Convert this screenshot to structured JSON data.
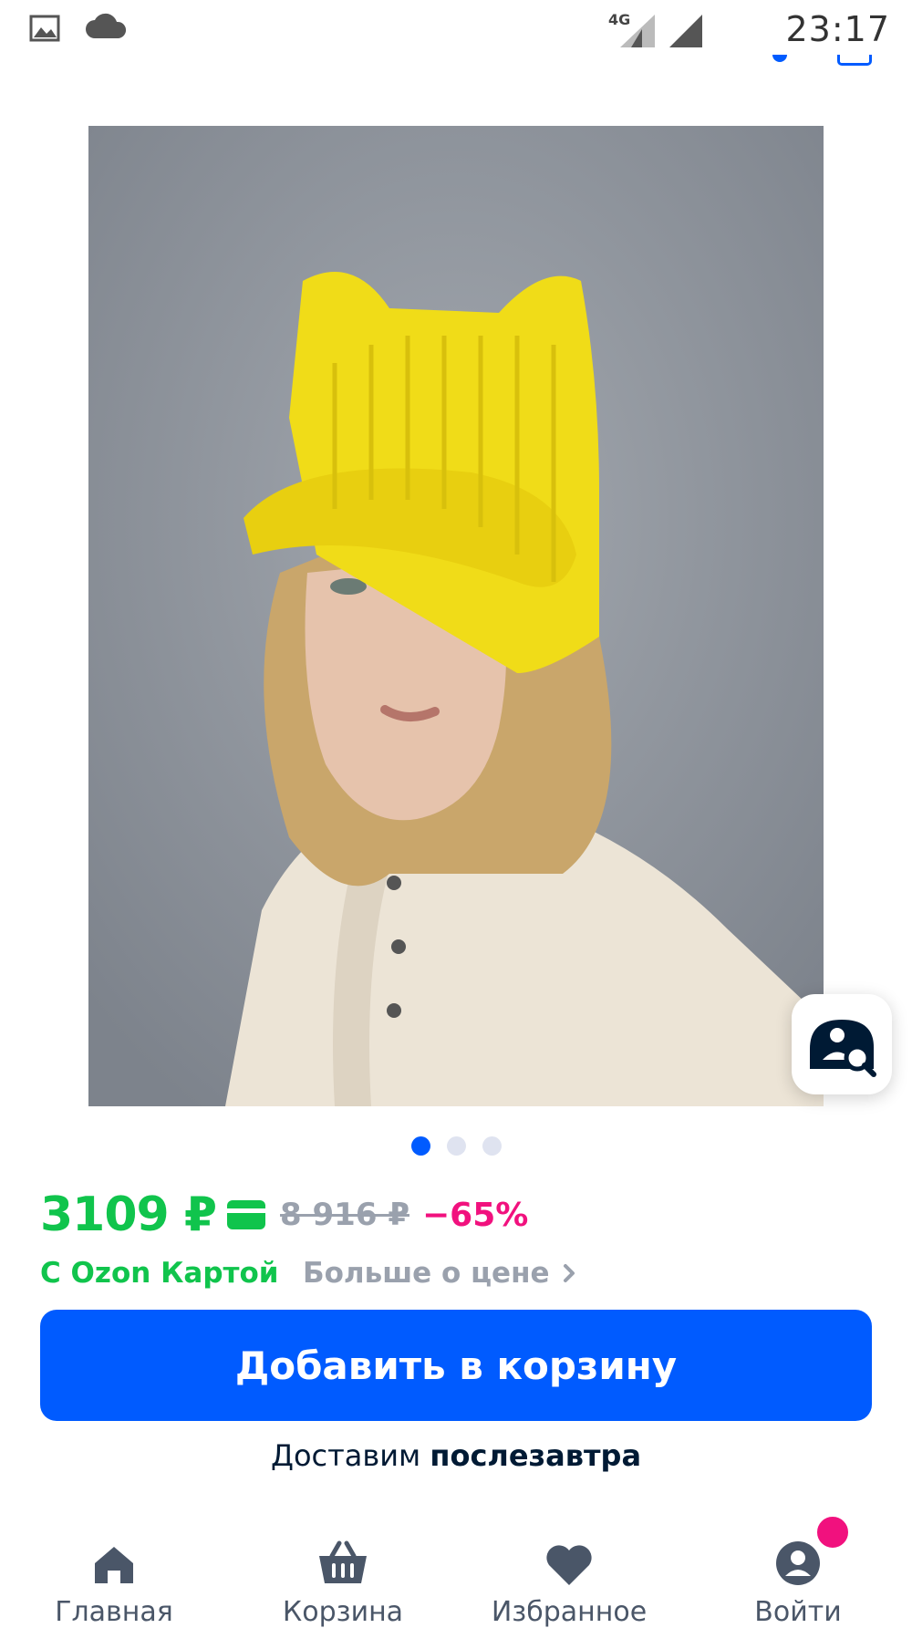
{
  "status_bar": {
    "time": "23:17",
    "network": "4G"
  },
  "product": {
    "image_alt": "yellow-knit-cat-ear-cap-photo",
    "gallery_count": 3,
    "gallery_active_index": 0
  },
  "price": {
    "current": "3109 ₽",
    "old": "8 916 ₽",
    "discount": "−65%",
    "card_label": "С Ozon Картой",
    "more_label": "Больше о цене"
  },
  "actions": {
    "add_to_cart": "Добавить в корзину"
  },
  "delivery": {
    "prefix": "Доставим",
    "when": "послезавтра"
  },
  "nav": {
    "items": [
      {
        "label": "Главная",
        "icon": "home-icon"
      },
      {
        "label": "Корзина",
        "icon": "basket-icon"
      },
      {
        "label": "Избранное",
        "icon": "heart-icon"
      },
      {
        "label": "Войти",
        "icon": "profile-icon"
      }
    ]
  },
  "colors": {
    "accent": "#005bff",
    "price_green": "#10c44c",
    "discount_pink": "#f1117e",
    "muted": "#9aa1ad"
  }
}
